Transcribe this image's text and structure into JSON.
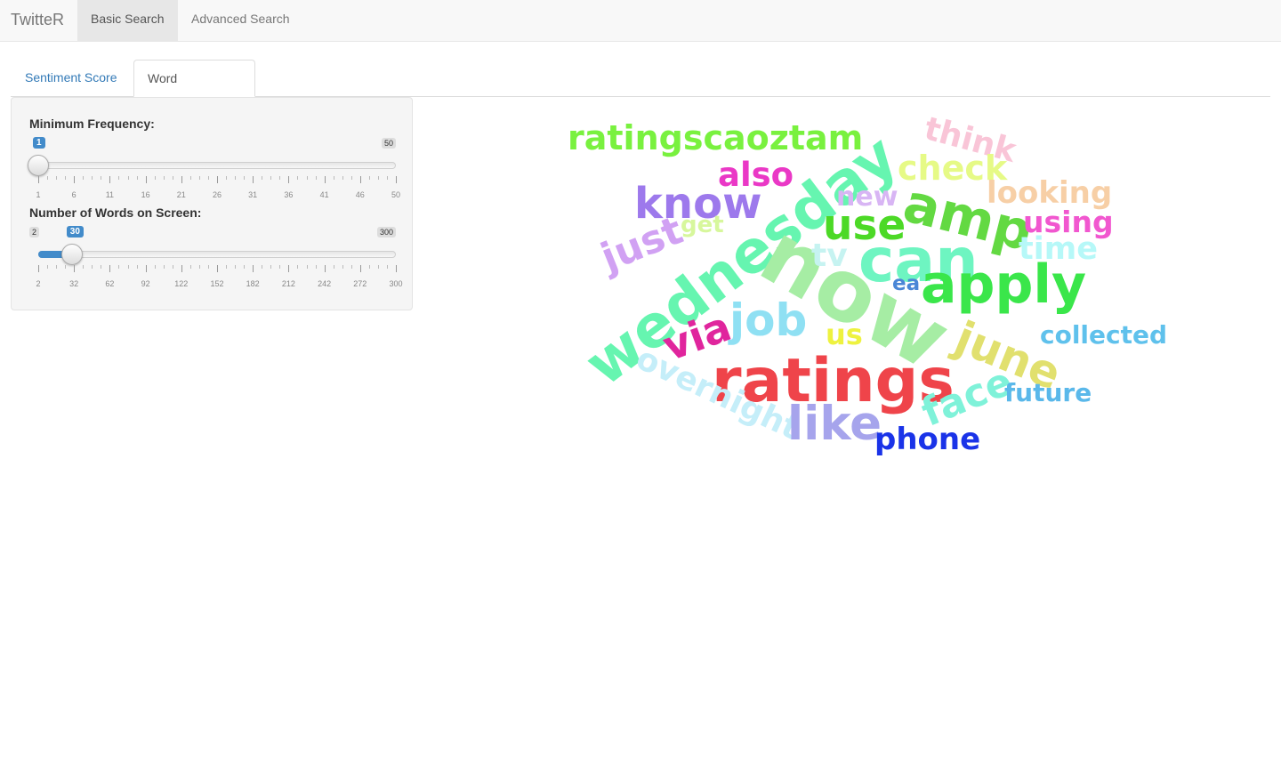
{
  "navbar": {
    "brand": "TwitteR",
    "items": [
      {
        "label": "Basic Search",
        "active": true
      },
      {
        "label": "Advanced Search",
        "active": false
      }
    ]
  },
  "tabs": [
    {
      "label": "Sentiment Score",
      "active": false
    },
    {
      "label": "Word Correlation",
      "active": true
    }
  ],
  "controls": {
    "min_freq": {
      "label": "Minimum Frequency:",
      "value": 1,
      "min": 1,
      "max": 50,
      "min_label": "1",
      "max_label": "50",
      "value_label": "1",
      "grid": [
        "1",
        "6",
        "11",
        "16",
        "21",
        "26",
        "31",
        "36",
        "41",
        "46",
        "50"
      ]
    },
    "num_words": {
      "label": "Number of Words on Screen:",
      "value": 30,
      "min": 2,
      "max": 300,
      "min_label": "2",
      "max_label": "300",
      "value_label": "30",
      "grid": [
        "2",
        "32",
        "62",
        "92",
        "122",
        "152",
        "182",
        "212",
        "242",
        "272",
        "300"
      ]
    }
  },
  "wordcloud": {
    "words": [
      {
        "text": "ratingscaoztam",
        "color": "#79f13f"
      },
      {
        "text": "wednesday",
        "color": "#66f5b0"
      },
      {
        "text": "think",
        "color": "#f9c5d7"
      },
      {
        "text": "check",
        "color": "#e6fa86"
      },
      {
        "text": "also",
        "color": "#ea38c6"
      },
      {
        "text": "know",
        "color": "#9d79ec"
      },
      {
        "text": "amp",
        "color": "#63d942"
      },
      {
        "text": "looking",
        "color": "#f7cfa6"
      },
      {
        "text": "new",
        "color": "#d8b5f4"
      },
      {
        "text": "use",
        "color": "#4cd926"
      },
      {
        "text": "using",
        "color": "#f157cf"
      },
      {
        "text": "get",
        "color": "#d7f79c"
      },
      {
        "text": "just",
        "color": "#d1a1f3"
      },
      {
        "text": "now",
        "color": "#a6eda4"
      },
      {
        "text": "can",
        "color": "#6ef5c1"
      },
      {
        "text": "tv",
        "color": "#c6f3f1"
      },
      {
        "text": "time",
        "color": "#b6f8f8"
      },
      {
        "text": "ea",
        "color": "#4a86d6"
      },
      {
        "text": "apply",
        "color": "#3ae64a"
      },
      {
        "text": "via",
        "color": "#e0259d"
      },
      {
        "text": "job",
        "color": "#8fe0f3"
      },
      {
        "text": "us",
        "color": "#eef23f"
      },
      {
        "text": "june",
        "color": "#e1e06e"
      },
      {
        "text": "collected",
        "color": "#5fc1ec"
      },
      {
        "text": "ratings",
        "color": "#ef444a"
      },
      {
        "text": "overnight",
        "color": "#c5eef9"
      },
      {
        "text": "face",
        "color": "#7ff2d9"
      },
      {
        "text": "future",
        "color": "#5ab8ea"
      },
      {
        "text": "like",
        "color": "#a6a4ec"
      },
      {
        "text": "phone",
        "color": "#1a33e8"
      }
    ]
  }
}
